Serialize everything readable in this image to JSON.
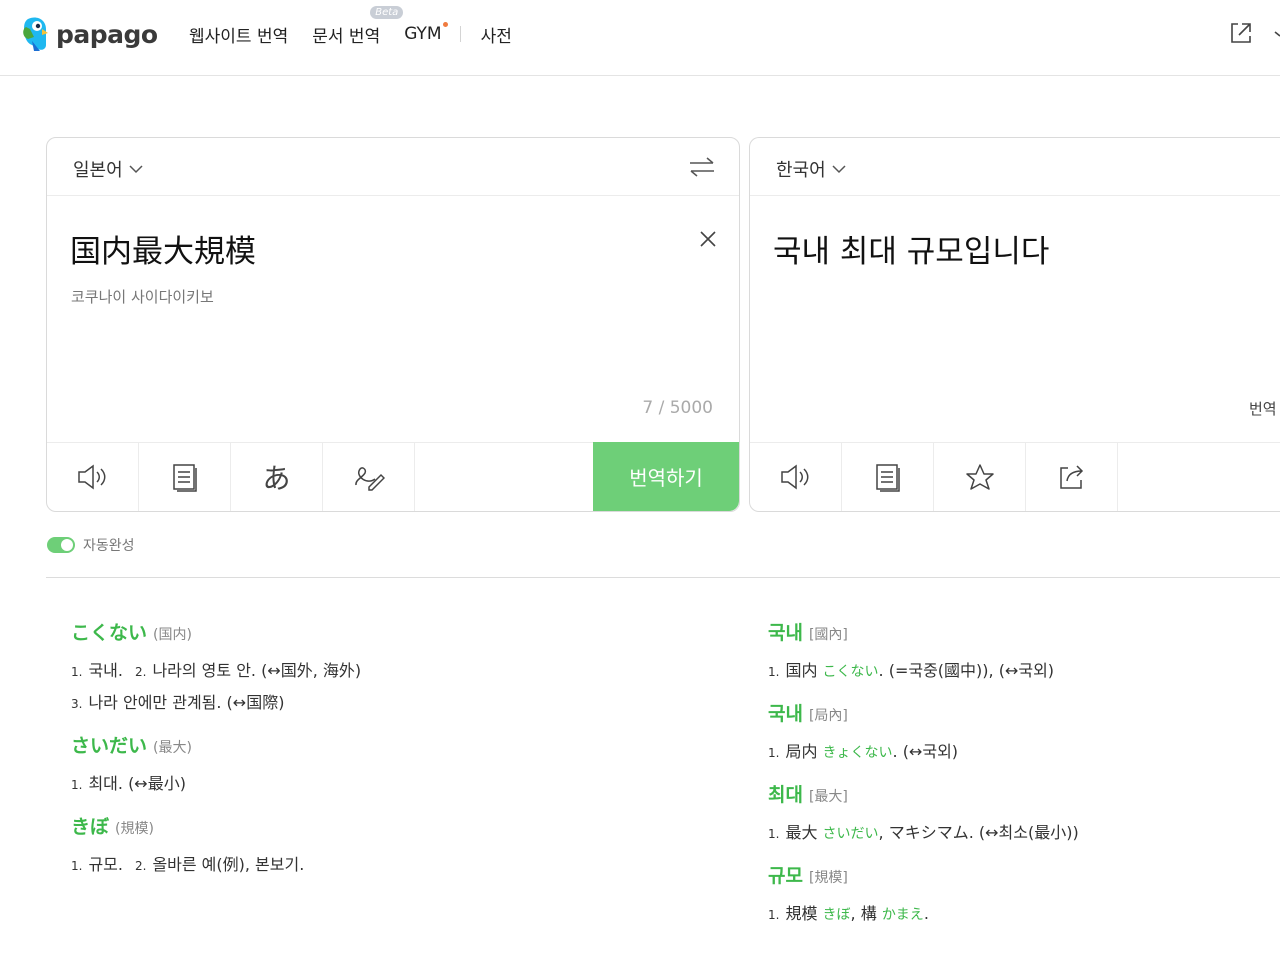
{
  "header": {
    "logo_text": "papago",
    "nav": [
      {
        "label": "웹사이트 번역"
      },
      {
        "label": "문서 번역",
        "badge": "Beta"
      },
      {
        "label": "GYM"
      },
      {
        "label": "사전"
      }
    ],
    "icons": [
      "external-link-icon"
    ]
  },
  "source": {
    "language": "일본어",
    "text": "国内最大規模",
    "phonetic": "코쿠나이 사이다이키보",
    "counter": "7 / 5000",
    "translate_button": "번역하기",
    "tools": [
      "speaker-icon",
      "notes-icon",
      "hiragana-icon",
      "handwriting-icon"
    ]
  },
  "target": {
    "language": "한국어",
    "text": "국내 최대 규모입니다",
    "side_label": "번역",
    "tools": [
      "speaker-icon",
      "notes-icon",
      "star-icon",
      "share-icon"
    ]
  },
  "autocomplete": {
    "label": "자동완성",
    "enabled": true
  },
  "colors": {
    "accent": "#6ecf78",
    "headword": "#3db84b"
  },
  "dictionary_left": [
    {
      "headword": "こくない",
      "hanja": "(国内)",
      "lines": [
        [
          {
            "n": "1.",
            "t": "국내."
          },
          {
            "n": "2.",
            "t": "나라의 영토 안. (↔国外, 海外)"
          }
        ],
        [
          {
            "n": "3.",
            "t": "나라 안에만 관계됨. (↔国際)"
          }
        ]
      ]
    },
    {
      "headword": "さいだい",
      "hanja": "(最大)",
      "lines": [
        [
          {
            "n": "1.",
            "t": "최대. (↔最小)"
          }
        ]
      ]
    },
    {
      "headword": "きぼ",
      "hanja": "(規模)",
      "lines": [
        [
          {
            "n": "1.",
            "t": "규모."
          },
          {
            "n": "2.",
            "t": "올바른 예(例), 본보기."
          }
        ]
      ]
    }
  ],
  "dictionary_right": [
    {
      "headword": "국내",
      "hanja": "[國內]",
      "line": {
        "n": "1.",
        "parts": [
          {
            "t": "国内 "
          },
          {
            "t": "こくない",
            "jp": true
          },
          {
            "t": ". (=국중(國中)), (↔국외)"
          }
        ]
      }
    },
    {
      "headword": "국내",
      "hanja": "[局內]",
      "line": {
        "n": "1.",
        "parts": [
          {
            "t": "局内 "
          },
          {
            "t": "きょくない",
            "jp": true
          },
          {
            "t": ". (↔국외)"
          }
        ]
      }
    },
    {
      "headword": "최대",
      "hanja": "[最大]",
      "line": {
        "n": "1.",
        "parts": [
          {
            "t": "最大 "
          },
          {
            "t": "さいだい",
            "jp": true
          },
          {
            "t": ", マキシマム. (↔최소(最小))"
          }
        ]
      }
    },
    {
      "headword": "규모",
      "hanja": "[規模]",
      "line": {
        "n": "1.",
        "parts": [
          {
            "t": "規模 "
          },
          {
            "t": "きぼ",
            "jp": true
          },
          {
            "t": ", 構 "
          },
          {
            "t": "かまえ",
            "jp": true
          },
          {
            "t": "."
          }
        ]
      }
    }
  ]
}
